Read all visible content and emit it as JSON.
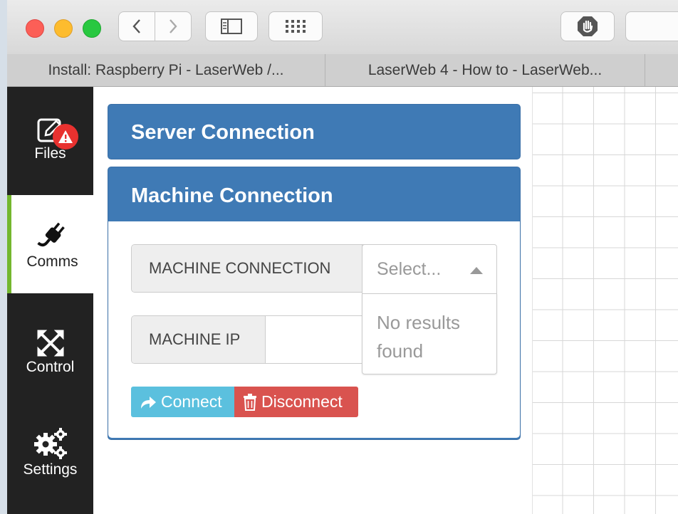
{
  "browser": {
    "tabs": [
      {
        "label": "Install: Raspberry Pi - LaserWeb /..."
      },
      {
        "label": "LaserWeb 4 - How to - LaserWeb..."
      }
    ]
  },
  "sidebar": {
    "items": [
      {
        "label": "Files",
        "icon": "file-edit-icon",
        "badge": "warning-icon"
      },
      {
        "label": "Comms",
        "icon": "plug-icon"
      },
      {
        "label": "Control",
        "icon": "arrows-expand-icon"
      },
      {
        "label": "Settings",
        "icon": "gears-icon"
      }
    ],
    "active_color": "#74b72e"
  },
  "server_panel": {
    "title": "Server Connection"
  },
  "machine_panel": {
    "title": "Machine Connection",
    "connection_label": "MACHINE CONNECTION",
    "select_placeholder": "Select...",
    "dropdown_message": "No results found",
    "ip_label": "MACHINE IP",
    "ip_value": "",
    "connect_label": "Connect",
    "disconnect_label": "Disconnect"
  },
  "colors": {
    "panel_header": "#3f7ab5",
    "connect": "#5bc0de",
    "disconnect": "#d9534f"
  }
}
